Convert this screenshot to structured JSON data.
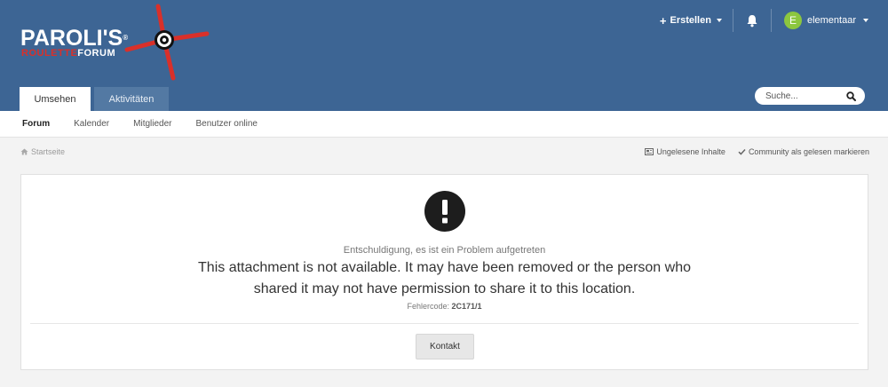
{
  "brand": {
    "title": "PAROLI'S",
    "registered": "®",
    "sub_red": "ROULETTE",
    "sub_white": "FORUM",
    "colors": {
      "header": "#3d6594",
      "red": "#d9302a"
    }
  },
  "userbar": {
    "create_label": "Erstellen",
    "username": "elementaar",
    "avatar_letter": "E",
    "avatar_color": "#8cc63f"
  },
  "main_tabs": [
    {
      "label": "Umsehen",
      "active": true
    },
    {
      "label": "Aktivitäten",
      "active": false
    }
  ],
  "search": {
    "placeholder": "Suche..."
  },
  "subnav": [
    {
      "label": "Forum",
      "active": true
    },
    {
      "label": "Kalender",
      "active": false
    },
    {
      "label": "Mitglieder",
      "active": false
    },
    {
      "label": "Benutzer online",
      "active": false
    }
  ],
  "breadcrumb": {
    "home": "Startseite"
  },
  "crumb_actions": {
    "unread": "Ungelesene Inhalte",
    "mark_read": "Community als gelesen markieren"
  },
  "error": {
    "heading": "Entschuldigung, es ist ein Problem aufgetreten",
    "message": "This attachment is not available. It may have been removed or the person who shared it may not have permission to share it to this location.",
    "code_label": "Fehlercode:",
    "code": "2C171/1",
    "contact_button": "Kontakt"
  }
}
